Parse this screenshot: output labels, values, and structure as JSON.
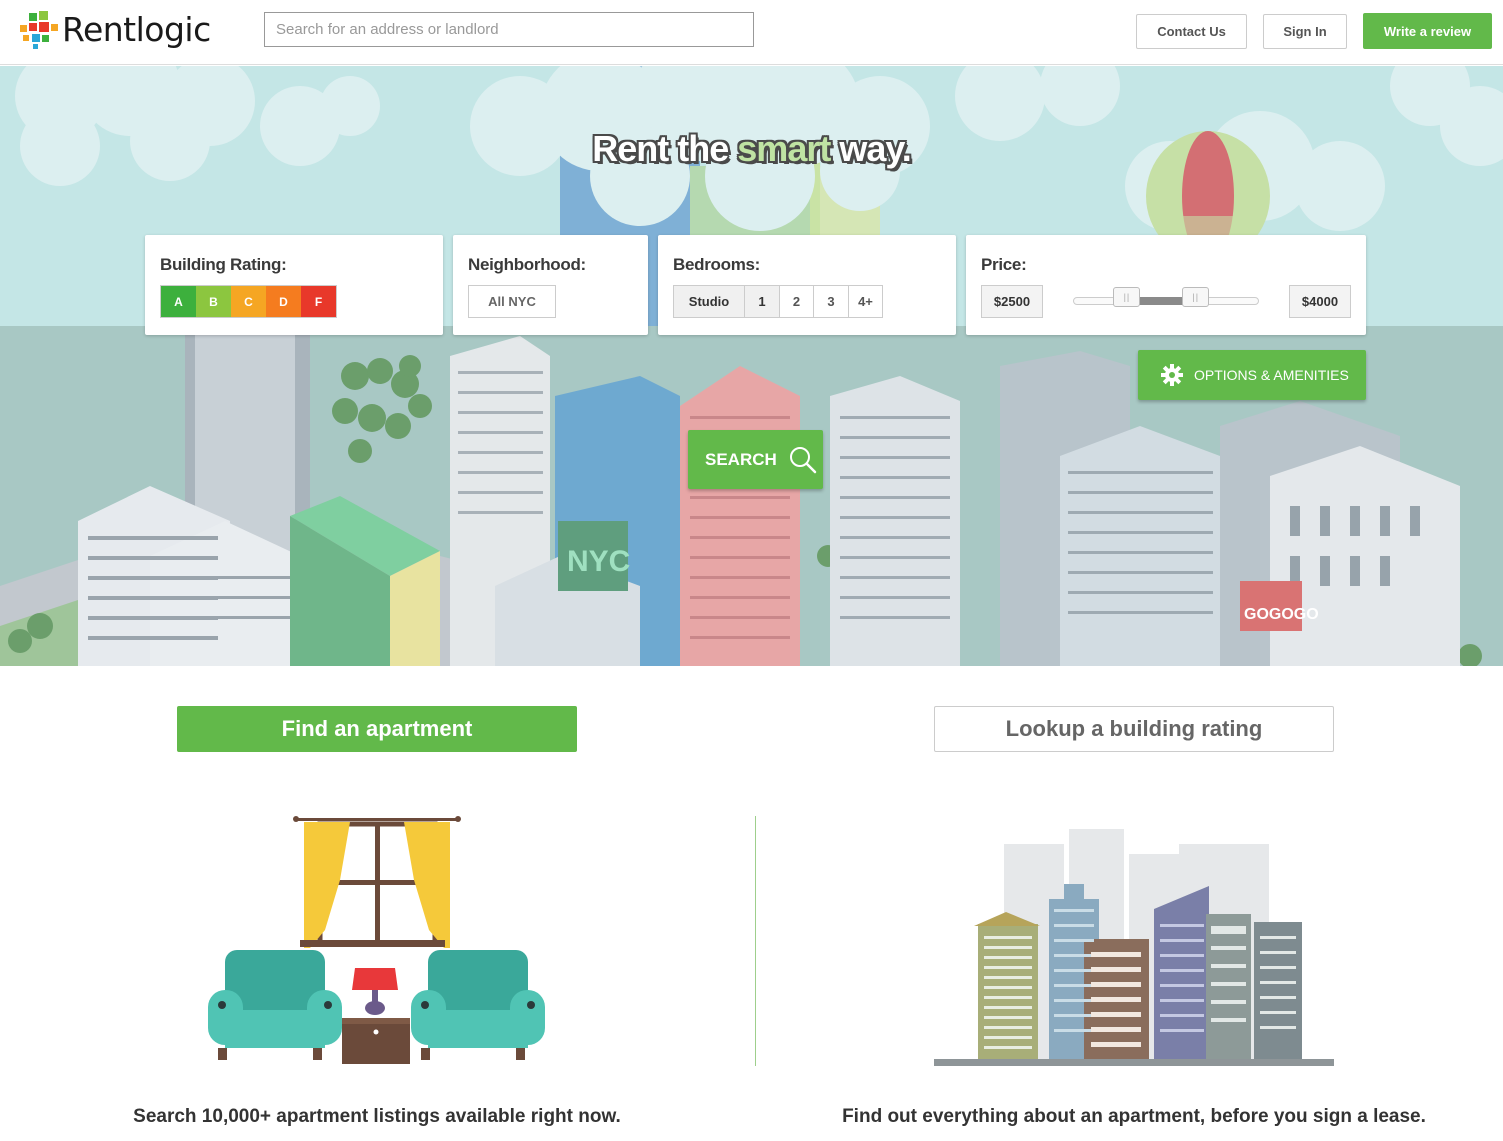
{
  "header": {
    "logo_text": "Rentlogic",
    "search_placeholder": "Search for an address or landlord",
    "contact_label": "Contact Us",
    "signin_label": "Sign In",
    "review_label": "Write a review"
  },
  "hero": {
    "title_part1": "Rent the ",
    "title_smart": "smart",
    "title_part2": " way.",
    "sign_nyc": "NYC",
    "sign_gogogo": "GOGOGO",
    "rating": {
      "label": "Building Rating:",
      "grades": [
        {
          "letter": "A",
          "color": "#3db03d"
        },
        {
          "letter": "B",
          "color": "#8cc63f"
        },
        {
          "letter": "C",
          "color": "#f5a623"
        },
        {
          "letter": "D",
          "color": "#f57c1f"
        },
        {
          "letter": "F",
          "color": "#e8382a"
        }
      ]
    },
    "neighborhood": {
      "label": "Neighborhood:",
      "value": "All NYC"
    },
    "bedrooms": {
      "label": "Bedrooms:",
      "options": [
        "Studio",
        "1",
        "2",
        "3",
        "4+"
      ]
    },
    "price": {
      "label": "Price:",
      "min": "$2500",
      "max": "$4000",
      "range_low_fraction": 0.29,
      "range_high_fraction": 0.66
    },
    "options_label": "OPTIONS & AMENITIES",
    "search_label": "SEARCH"
  },
  "lower": {
    "find_label": "Find an apartment",
    "lookup_label": "Lookup a building rating",
    "find_caption": "Search 10,000+ apartment listings available right now.",
    "lookup_caption": "Find out everything about an apartment, before you sign a lease."
  },
  "colors": {
    "brand_green": "#62b94a",
    "sky": "#bfe3e3"
  }
}
